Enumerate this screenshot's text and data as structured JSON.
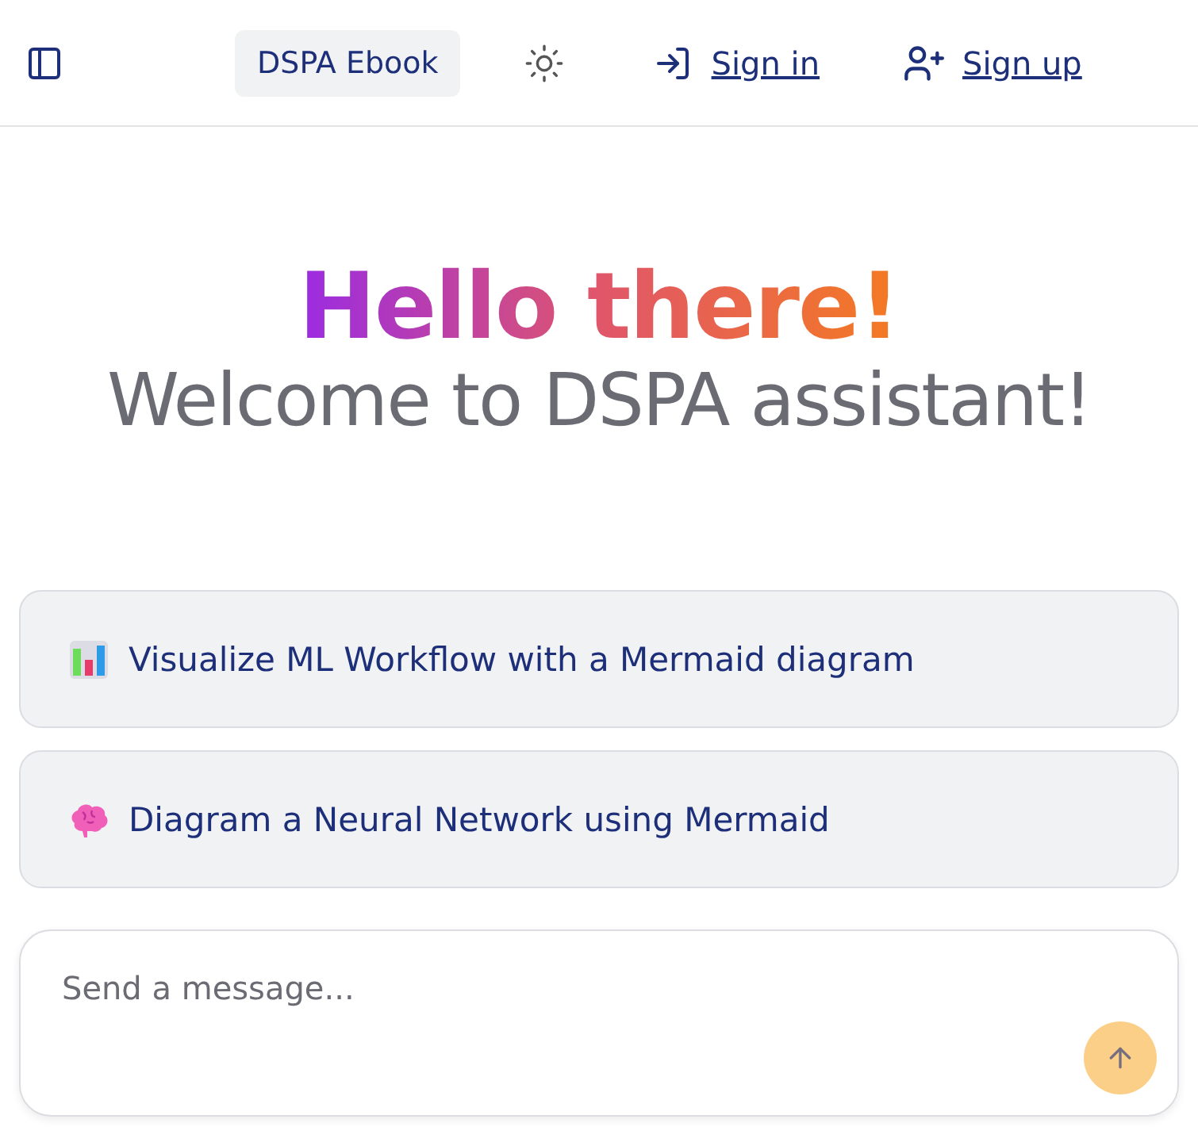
{
  "header": {
    "ebook_button": "DSPA Ebook",
    "sign_in": "Sign in",
    "sign_up": "Sign up"
  },
  "greeting": {
    "title": "Hello there!",
    "subtitle": "Welcome to DSPA assistant!"
  },
  "suggestions": [
    {
      "kind": "chart",
      "text": "Visualize ML Workflow with a Mermaid diagram"
    },
    {
      "kind": "brain",
      "text": "Diagram a Neural Network using Mermaid"
    }
  ],
  "composer": {
    "placeholder": "Send a message...",
    "send_disabled": true
  }
}
